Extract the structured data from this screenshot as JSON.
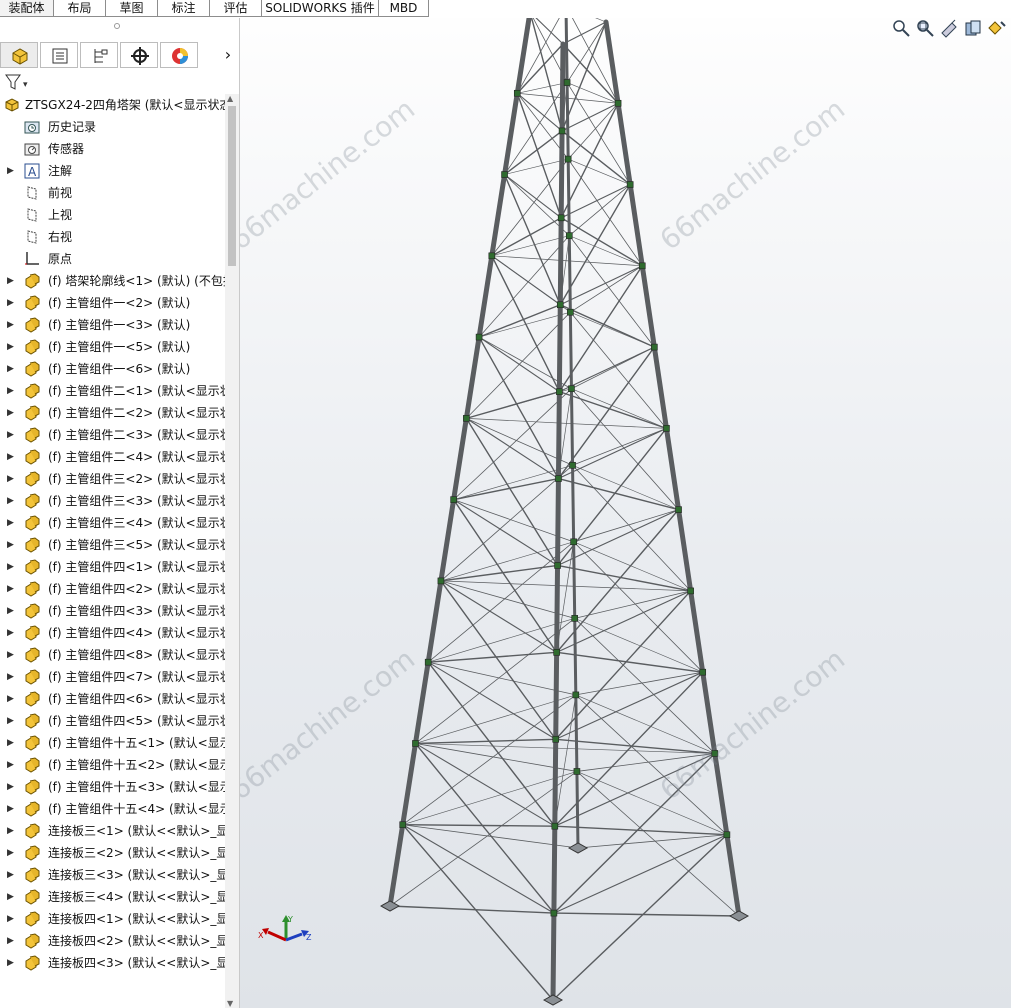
{
  "tabs": [
    {
      "label": "装配体",
      "active": true
    },
    {
      "label": "布局"
    },
    {
      "label": "草图"
    },
    {
      "label": "标注"
    },
    {
      "label": "评估"
    },
    {
      "label": "SOLIDWORKS 插件"
    },
    {
      "label": "MBD"
    }
  ],
  "panel": {
    "tabs": [
      "feature-manager",
      "property-manager",
      "configuration-manager",
      "dimxpert-manager",
      "display-manager"
    ],
    "next_symbol": "›",
    "filter_symbol": "▾"
  },
  "tree": {
    "root": "ZTSGX24-2四角塔架 (默认<显示状态",
    "items": [
      {
        "label": "历史记录",
        "icon": "history-icon"
      },
      {
        "label": "传感器",
        "icon": "sensor-icon"
      },
      {
        "label": "注解",
        "icon": "annotation-icon",
        "arrow": true
      },
      {
        "label": "前视",
        "icon": "plane-icon"
      },
      {
        "label": "上视",
        "icon": "plane-icon"
      },
      {
        "label": "右视",
        "icon": "plane-icon"
      },
      {
        "label": "原点",
        "icon": "origin-icon"
      },
      {
        "label": "(f) 塔架轮廓线<1> (默认) (不包括",
        "icon": "part-icon",
        "arrow": true
      },
      {
        "label": "(f) 主管组件一<2> (默认)",
        "icon": "part-icon",
        "arrow": true
      },
      {
        "label": "(f) 主管组件一<3> (默认)",
        "icon": "part-icon",
        "arrow": true
      },
      {
        "label": "(f) 主管组件一<5> (默认)",
        "icon": "part-icon",
        "arrow": true
      },
      {
        "label": "(f) 主管组件一<6> (默认)",
        "icon": "part-icon",
        "arrow": true
      },
      {
        "label": "(f) 主管组件二<1> (默认<显示状",
        "icon": "part-icon",
        "arrow": true
      },
      {
        "label": "(f) 主管组件二<2> (默认<显示状",
        "icon": "part-icon",
        "arrow": true
      },
      {
        "label": "(f) 主管组件二<3> (默认<显示状",
        "icon": "part-icon",
        "arrow": true
      },
      {
        "label": "(f) 主管组件二<4> (默认<显示状",
        "icon": "part-icon",
        "arrow": true
      },
      {
        "label": "(f) 主管组件三<2> (默认<显示状",
        "icon": "part-icon",
        "arrow": true
      },
      {
        "label": "(f) 主管组件三<3> (默认<显示状",
        "icon": "part-icon",
        "arrow": true
      },
      {
        "label": "(f) 主管组件三<4> (默认<显示状",
        "icon": "part-icon",
        "arrow": true
      },
      {
        "label": "(f) 主管组件三<5> (默认<显示状",
        "icon": "part-icon",
        "arrow": true
      },
      {
        "label": "(f) 主管组件四<1> (默认<显示状",
        "icon": "part-icon",
        "arrow": true
      },
      {
        "label": "(f) 主管组件四<2> (默认<显示状",
        "icon": "part-icon",
        "arrow": true
      },
      {
        "label": "(f) 主管组件四<3> (默认<显示状",
        "icon": "part-icon",
        "arrow": true
      },
      {
        "label": "(f) 主管组件四<4> (默认<显示状",
        "icon": "part-icon",
        "arrow": true
      },
      {
        "label": "(f) 主管组件四<8> (默认<显示状",
        "icon": "part-icon",
        "arrow": true
      },
      {
        "label": "(f) 主管组件四<7> (默认<显示状",
        "icon": "part-icon",
        "arrow": true
      },
      {
        "label": "(f) 主管组件四<6> (默认<显示状",
        "icon": "part-icon",
        "arrow": true
      },
      {
        "label": "(f) 主管组件四<5> (默认<显示状",
        "icon": "part-icon",
        "arrow": true
      },
      {
        "label": "(f) 主管组件十五<1> (默认<显示",
        "icon": "part-icon",
        "arrow": true
      },
      {
        "label": "(f) 主管组件十五<2> (默认<显示",
        "icon": "part-icon",
        "arrow": true
      },
      {
        "label": "(f) 主管组件十五<3> (默认<显示",
        "icon": "part-icon",
        "arrow": true
      },
      {
        "label": "(f) 主管组件十五<4> (默认<显示",
        "icon": "part-icon",
        "arrow": true
      },
      {
        "label": "连接板三<1> (默认<<默认>_显",
        "icon": "part-icon",
        "arrow": true
      },
      {
        "label": "连接板三<2> (默认<<默认>_显",
        "icon": "part-icon",
        "arrow": true
      },
      {
        "label": "连接板三<3> (默认<<默认>_显",
        "icon": "part-icon",
        "arrow": true
      },
      {
        "label": "连接板三<4> (默认<<默认>_显",
        "icon": "part-icon",
        "arrow": true
      },
      {
        "label": "连接板四<1> (默认<<默认>_显",
        "icon": "part-icon",
        "arrow": true
      },
      {
        "label": "连接板四<2> (默认<<默认>_显",
        "icon": "part-icon",
        "arrow": true
      },
      {
        "label": "连接板四<3> (默认<<默认>_显",
        "icon": "part-icon",
        "arrow": true
      }
    ]
  },
  "viewport": {
    "hud_icons": [
      "zoom-to-fit-icon",
      "zoom-area-icon",
      "previous-view-icon",
      "section-view-icon",
      "view-orientation-icon"
    ],
    "watermark": "66machine.com",
    "triad": {
      "x": "X",
      "y": "Y",
      "z": "Z"
    },
    "colors": {
      "steel": "#5a5d60",
      "joint": "#2f6b2f",
      "x_axis": "#c00000",
      "y_axis": "#2d8f2d",
      "z_axis": "#1f3fbf"
    }
  }
}
